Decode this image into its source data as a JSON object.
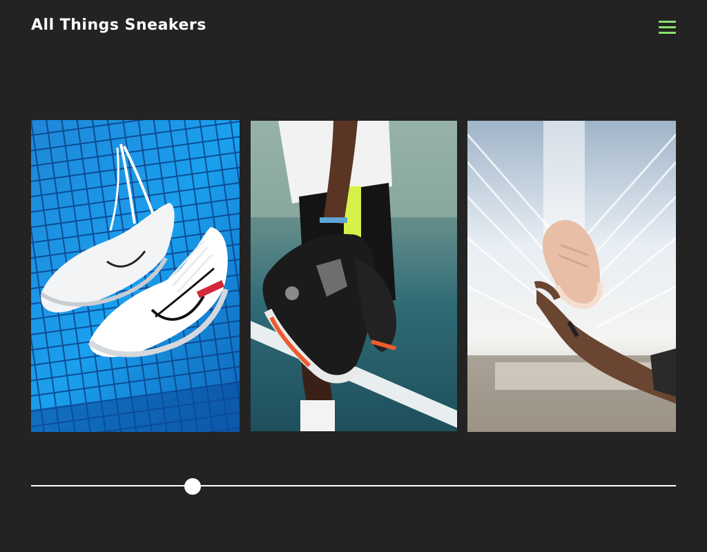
{
  "header": {
    "title": "All Things Sneakers",
    "menu_icon": "hamburger-menu-icon",
    "accent_color": "#8be36d"
  },
  "gallery": {
    "images": [
      {
        "name": "white-sneakers-on-net-image"
      },
      {
        "name": "black-red-sneakers-in-hand-image"
      },
      {
        "name": "pink-sneaker-tossed-image"
      }
    ]
  },
  "slider": {
    "value_fraction": 0.25
  }
}
